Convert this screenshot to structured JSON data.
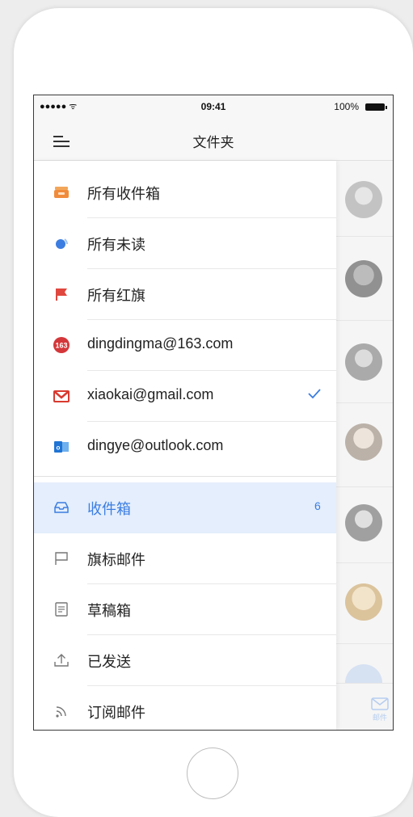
{
  "status_bar": {
    "signal": "●●●●● ᯤ",
    "time": "09:41",
    "battery": "100%"
  },
  "nav": {
    "title": "文件夹"
  },
  "accounts": [
    {
      "label": "所有收件箱",
      "icon": "inbox-all-icon"
    },
    {
      "label": "所有未读",
      "icon": "unread-dot-icon"
    },
    {
      "label": "所有红旗",
      "icon": "red-flag-icon"
    },
    {
      "label": "dingdingma@163.com",
      "icon": "163-mail-icon"
    },
    {
      "label": "xiaokai@gmail.com",
      "icon": "gmail-icon",
      "checked": true
    },
    {
      "label": "dingye@outlook.com",
      "icon": "outlook-icon"
    }
  ],
  "folders": [
    {
      "label": "收件箱",
      "icon": "inbox-tray-icon",
      "count": "6",
      "selected": true
    },
    {
      "label": "旗标邮件",
      "icon": "flag-outline-icon"
    },
    {
      "label": "草稿箱",
      "icon": "draft-icon"
    },
    {
      "label": "已发送",
      "icon": "upload-icon"
    },
    {
      "label": "订阅邮件",
      "icon": "rss-icon"
    }
  ],
  "tab_bar": {
    "mail_label": "邮件"
  },
  "colors": {
    "accent": "#3b7de1",
    "selected_bg": "#e4eefc",
    "flag_red": "#e0473e",
    "gmail_red": "#d93a30",
    "outlook_blue": "#1f74d4"
  }
}
